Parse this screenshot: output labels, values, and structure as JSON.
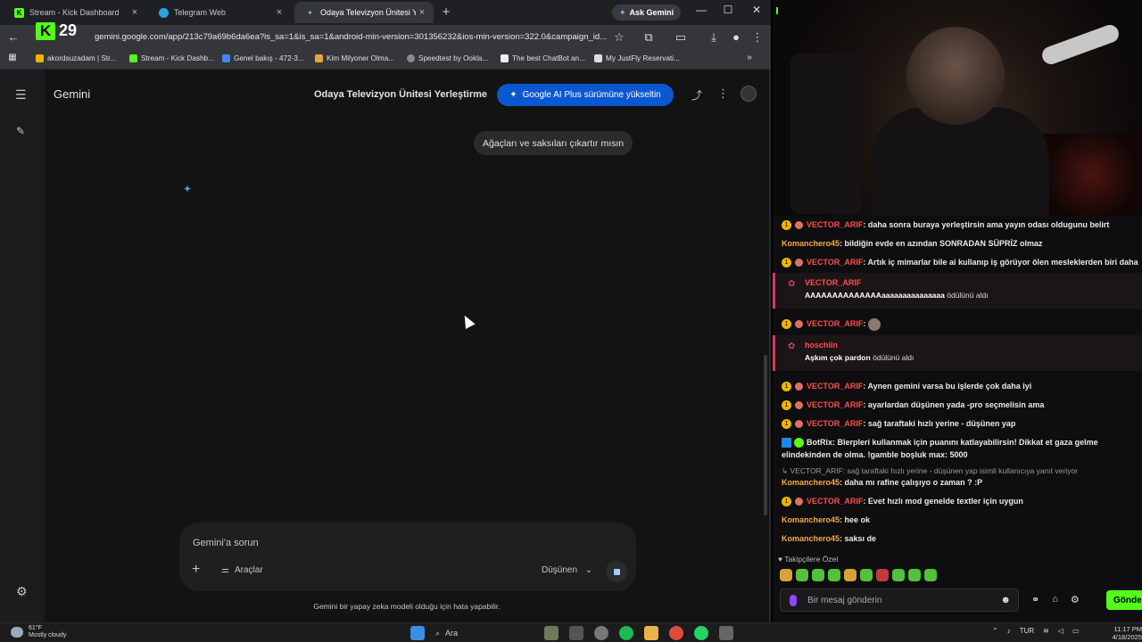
{
  "browser": {
    "tabs": [
      {
        "label": "Stream - Kick Dashboard",
        "close": "×"
      },
      {
        "label": "Telegram Web",
        "close": "×"
      },
      {
        "label": "Odaya Televizyon Ünitesi Yerleş",
        "close": "×"
      }
    ],
    "new_tab": "+",
    "ask_gemini": "Ask Gemini",
    "window_controls": {
      "minimize": "—",
      "maximize": "☐",
      "close": "✕"
    },
    "url": "gemini.google.com/app/213c79a69b6da6ea?is_sa=1&is_sa=1&android-min-version=301356232&ios-min-version=322.0&campaign_id...",
    "kick_overlay_count": "29",
    "bookmarks": [
      {
        "label": "akordsuzadam | Str...",
        "color": "#f0b400"
      },
      {
        "label": "Stream - Kick Dashb...",
        "color": "#53fc18"
      },
      {
        "label": "Genel bakış - 472-3...",
        "color": "#4285f4"
      },
      {
        "label": "Kim Milyoner Olma...",
        "color": "#e8a33d"
      },
      {
        "label": "Speedtest by Ookla...",
        "color": "#888888"
      },
      {
        "label": "The best ChatBot an...",
        "color": "#eeeeee"
      },
      {
        "label": "My JustFly Reservati...",
        "color": "#dddddd"
      }
    ]
  },
  "gemini": {
    "brand": "Gemini",
    "conversation_title": "Odaya Televizyon Ünitesi Yerleştirme",
    "upgrade_label": "Google AI Plus sürümüne yükseltin",
    "user_message": "Ağaçları ve saksıları çıkartır mısın",
    "input_placeholder": "Gemini'a sorun",
    "tools_label": "Araçlar",
    "mode_label": "Düşünen",
    "disclaimer": "Gemini bir yapay zeka modeli olduğu için hata yapabilir."
  },
  "stream": {
    "chat": [
      {
        "user": "VECTOR_ARIF",
        "text": ": daha sonra buraya yerleştirsin ama yayın odası oldugunu belirt"
      },
      {
        "user": "Komanchero45",
        "text": ": bildiğin evde en azından SONRADAN SÜPRİZ olmaz"
      },
      {
        "user": "VECTOR_ARIF",
        "text": ": Artık iç mimarlar bile ai kullanıp iş görüyor ölen mesleklerden biri daha"
      },
      {
        "user": "VECTOR_ARIF",
        "text": ": "
      },
      {
        "user": "VECTOR_ARIF",
        "text": ": Aynen gemini varsa bu işlerde çok daha iyi"
      },
      {
        "user": "VECTOR_ARIF",
        "text": ": ayarlardan düşünen yada -pro seçmelisin ama"
      },
      {
        "user": "VECTOR_ARIF",
        "text": ": sağ taraftaki hızlı yerine - düşünen yap"
      },
      {
        "user": "Komanchero45",
        "text": ": daha mı rafine çalışıyo o zaman ? :P"
      },
      {
        "user": "VECTOR_ARIF",
        "text": ": Evet hızlı mod genelde textler için uygun"
      },
      {
        "user": "Komanchero45",
        "text": ": hee ok"
      },
      {
        "user": "Komanchero45",
        "text": ": saksı de"
      }
    ],
    "rewards": [
      {
        "user": "VECTOR_ARIF",
        "text": "AAAAAAAAAAAAAAaaaaaaaaaaaaaaa",
        "suffix": "ödülünü aldı"
      },
      {
        "user": "hoschlin",
        "text": "Aşkım çok pardon",
        "suffix": "ödülünü aldı"
      }
    ],
    "bot": {
      "user": "BotRix",
      "text": ": Blerpleri kullanmak için puanını katlayabilirsin! Dikkat et gaza gelme elindekinden de olma. !gamble boşluk max: 5000"
    },
    "reply_ref": "↳ VECTOR_ARIF: sağ taraftaki hızlı yerine - düşünen yap isimli kullanıcıya yanıt veriyor",
    "followers_label": "Takipçilere Özel",
    "input_placeholder": "Bir mesaj gönderin",
    "send_label": "Gönder"
  },
  "taskbar": {
    "weather_temp": "61°F",
    "weather_desc": "Mostly cloudy",
    "search_label": "Ara",
    "lang": "TUR",
    "time": "11:17 PM",
    "date": "4/18/2025"
  }
}
